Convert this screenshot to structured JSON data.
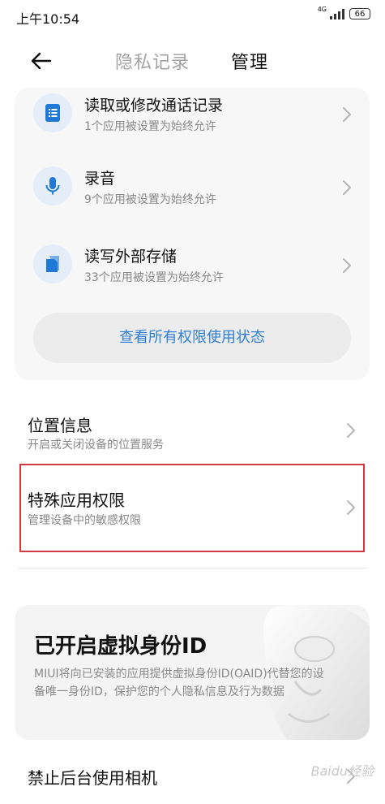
{
  "status_bar": {
    "time": "上午10:54",
    "network": "4G",
    "battery": "66"
  },
  "header": {
    "tab_privacy": "隐私记录",
    "tab_manage": "管理"
  },
  "permissions_card": {
    "items": [
      {
        "title": "读取或修改通话记录",
        "subtitle": "1个应用被设置为始终允许",
        "icon": "call-log-icon"
      },
      {
        "title": "录音",
        "subtitle": "9个应用被设置为始终允许",
        "icon": "microphone-icon"
      },
      {
        "title": "读写外部存储",
        "subtitle": "33个应用被设置为始终允许",
        "icon": "storage-icon"
      }
    ],
    "button_label": "查看所有权限使用状态",
    "accent_color": "#2f7fd6"
  },
  "location": {
    "title": "位置信息",
    "subtitle": "开启或关闭设备的位置服务"
  },
  "special": {
    "title": "特殊应用权限",
    "subtitle": "管理设备中的敏感权限",
    "highlight_color": "#d0393f"
  },
  "virtual_id": {
    "title": "已开启虚拟身份ID",
    "description": "MIUI将向已安装的应用提供虚拟身份ID(OAID)代替您的设备唯一身份ID，保护您的个人隐私信息及行为数据"
  },
  "camera": {
    "title": "禁止后台使用相机"
  },
  "watermark": "Baidu经验"
}
